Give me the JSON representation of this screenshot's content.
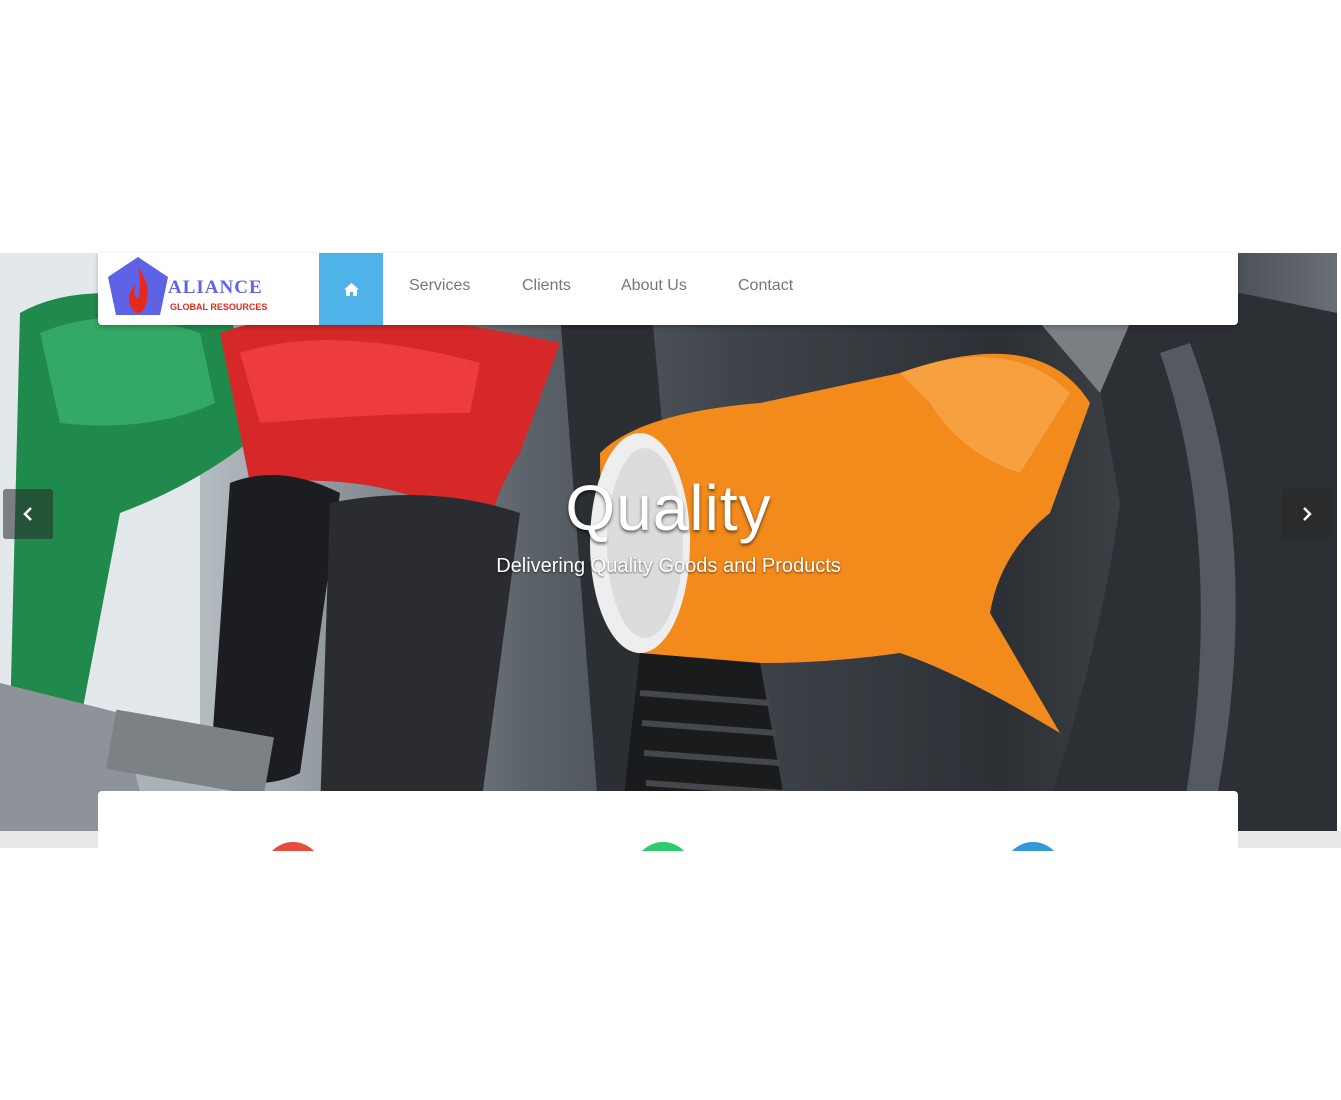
{
  "logo": {
    "name": "ALIANCE",
    "tagline": "GLOBAL RESOURCES"
  },
  "nav": {
    "home_icon": "home-icon",
    "items": [
      {
        "label": "Services"
      },
      {
        "label": "Clients"
      },
      {
        "label": "About Us"
      },
      {
        "label": "Contact"
      }
    ],
    "active_color": "#4fb3ea"
  },
  "hero": {
    "title": "Quality",
    "subtitle": "Delivering Quality Goods and Products",
    "prev_icon": "chevron-left-icon",
    "next_icon": "chevron-right-icon"
  },
  "features": [
    {
      "icon": "feature-circle-icon",
      "color": "#e74c3c"
    },
    {
      "icon": "feature-circle-icon",
      "color": "#2ecc71"
    },
    {
      "icon": "feature-circle-icon",
      "color": "#3498db"
    }
  ]
}
